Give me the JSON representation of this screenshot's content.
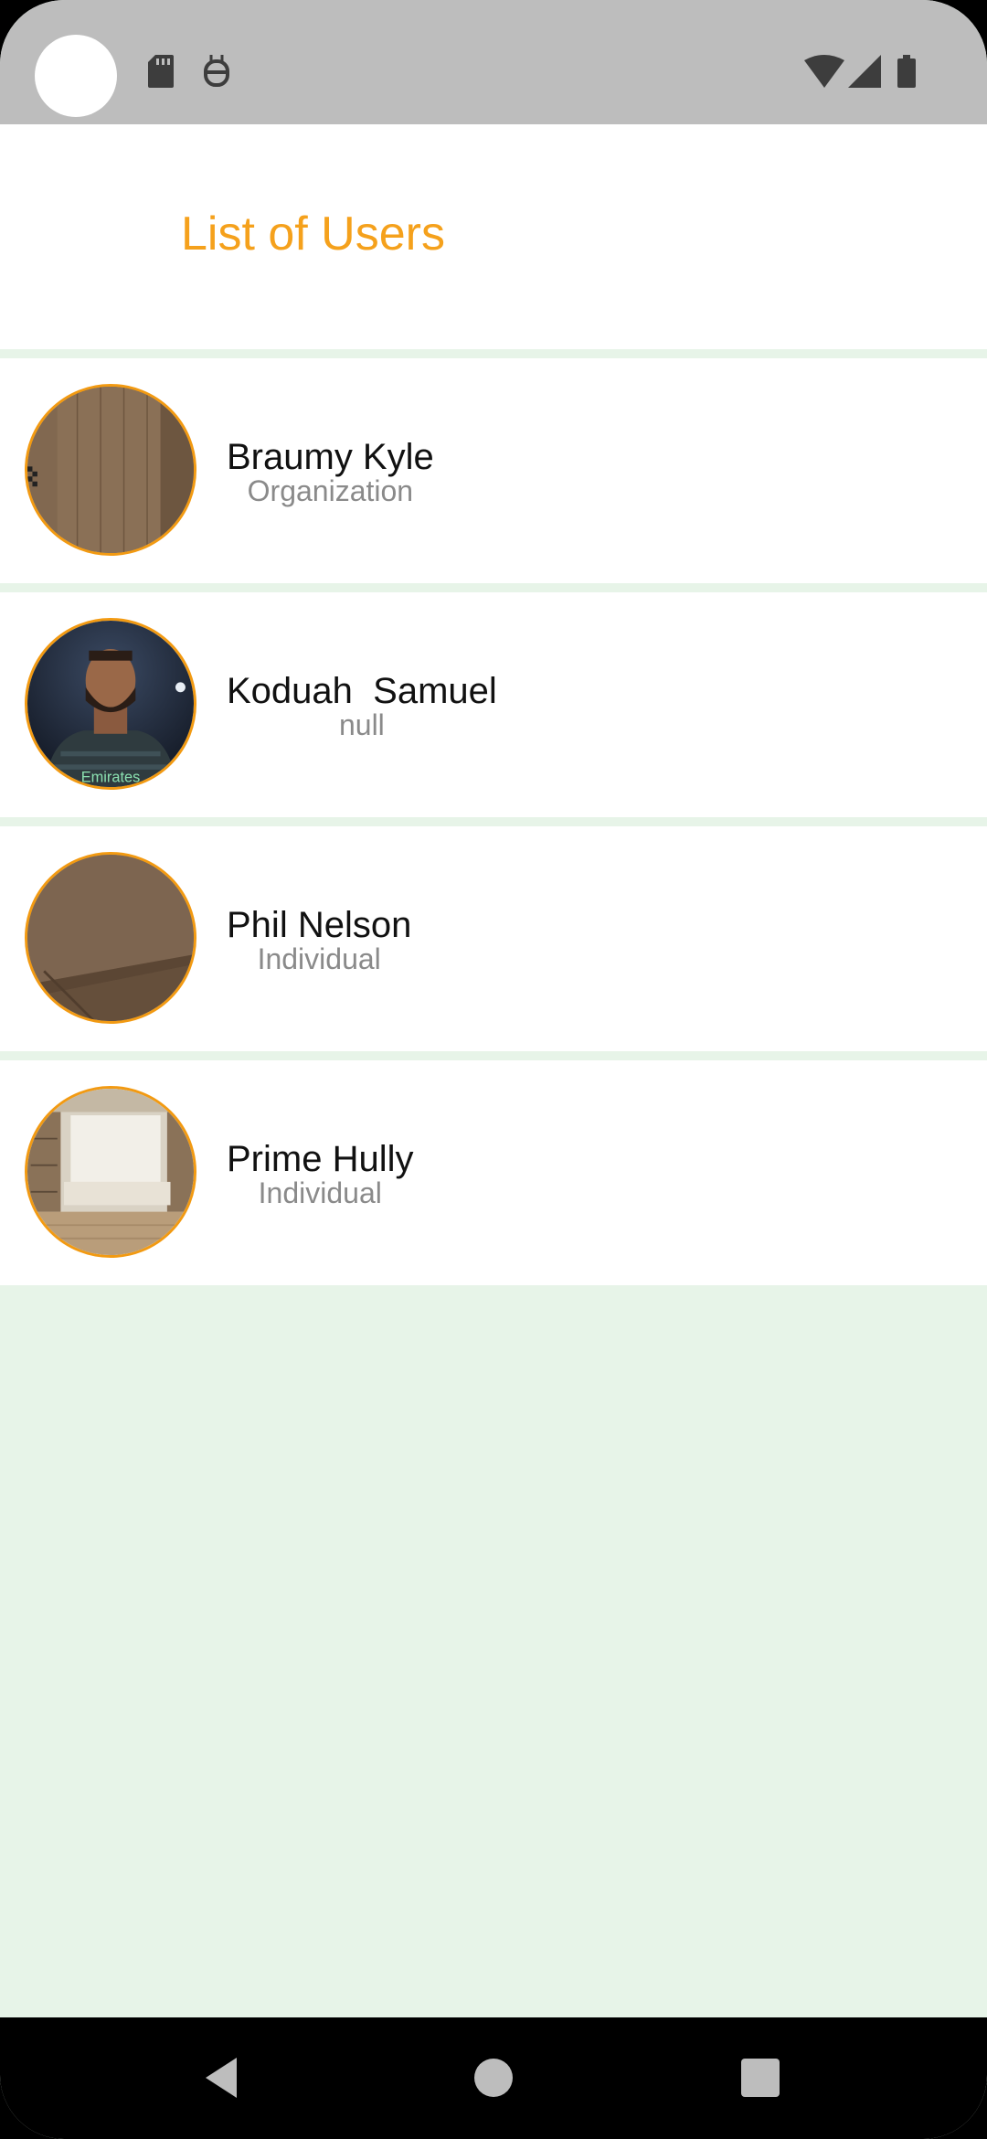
{
  "header": {
    "title": "List of Users"
  },
  "users": [
    {
      "name": "Braumy Kyle",
      "type": "Organization",
      "avatar": "room-door-photo"
    },
    {
      "name": "Koduah  Samuel",
      "type": "null",
      "avatar": "footballer-photo"
    },
    {
      "name": "Phil Nelson",
      "type": "Individual",
      "avatar": "wood-ceiling-photo"
    },
    {
      "name": "Prime Hully",
      "type": "Individual",
      "avatar": "bedroom-photo"
    }
  ],
  "colors": {
    "accent": "#f5a11c",
    "avatar_border": "#f29a12",
    "background": "#e7f4e8",
    "status_bar": "#bdbdbd"
  },
  "icons": {
    "status_left": [
      "sd-card-icon",
      "robot-icon"
    ],
    "status_right": [
      "wifi-icon",
      "cellular-signal-icon",
      "battery-icon"
    ],
    "nav": [
      "back-icon",
      "home-icon",
      "recents-icon"
    ]
  }
}
